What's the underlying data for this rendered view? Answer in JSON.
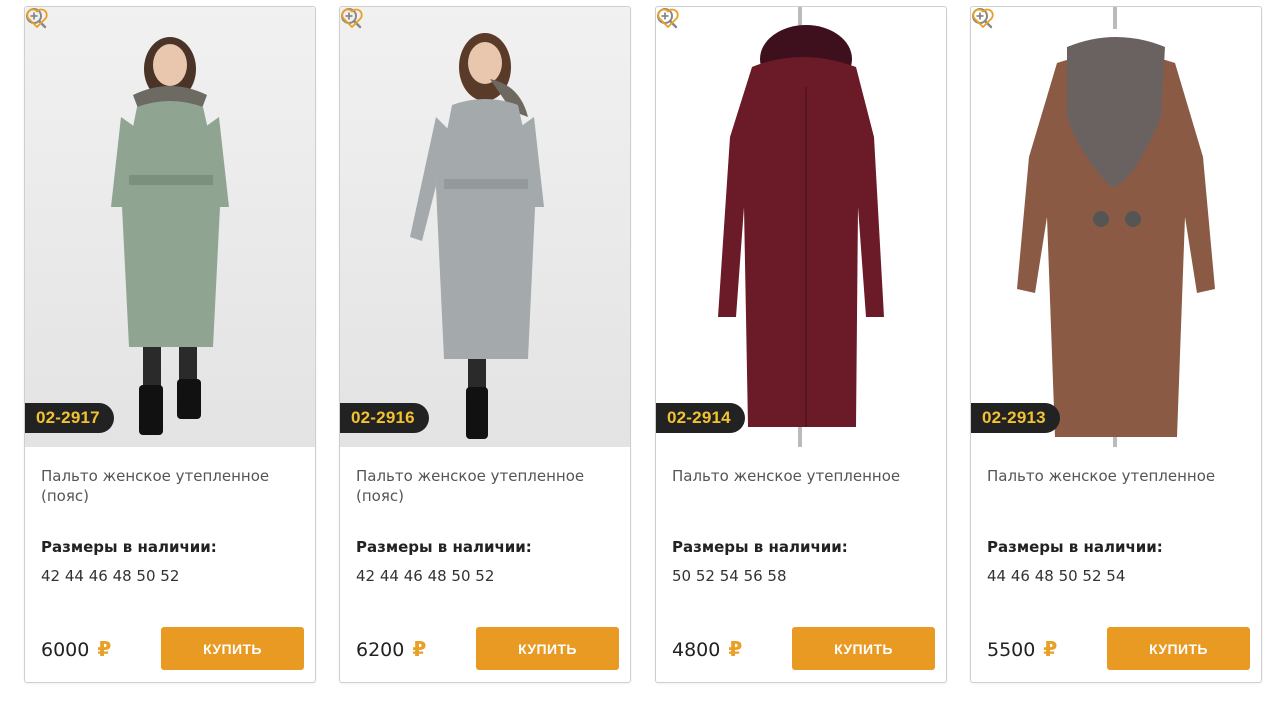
{
  "accent_color": "#e99a22",
  "badge_text_color": "#f2c230",
  "products": [
    {
      "article": "02-2917",
      "title": "Пальто женское утепленное (пояс)",
      "sizes_label": "Размеры в наличии:",
      "sizes": "42 44 46 48 50 52",
      "price": "6000",
      "currency": "₽",
      "buy_label": "КУПИТЬ",
      "coat_color": "#8fa592",
      "photo_type": "model"
    },
    {
      "article": "02-2916",
      "title": "Пальто женское утепленное (пояс)",
      "sizes_label": "Размеры в наличии:",
      "sizes": "42 44 46 48 50 52",
      "price": "6200",
      "currency": "₽",
      "buy_label": "КУПИТЬ",
      "coat_color": "#a4a9ab",
      "photo_type": "model"
    },
    {
      "article": "02-2914",
      "title": "Пальто женское утепленное",
      "sizes_label": "Размеры в наличии:",
      "sizes": "50 52 54 56 58",
      "price": "4800",
      "currency": "₽",
      "buy_label": "КУПИТЬ",
      "coat_color": "#6b1a27",
      "photo_type": "mannequin"
    },
    {
      "article": "02-2913",
      "title": "Пальто женское утепленное",
      "sizes_label": "Размеры в наличии:",
      "sizes": "44 46 48 50 52 54",
      "price": "5500",
      "currency": "₽",
      "buy_label": "КУПИТЬ",
      "coat_color": "#8a5a45",
      "photo_type": "mannequin"
    }
  ]
}
